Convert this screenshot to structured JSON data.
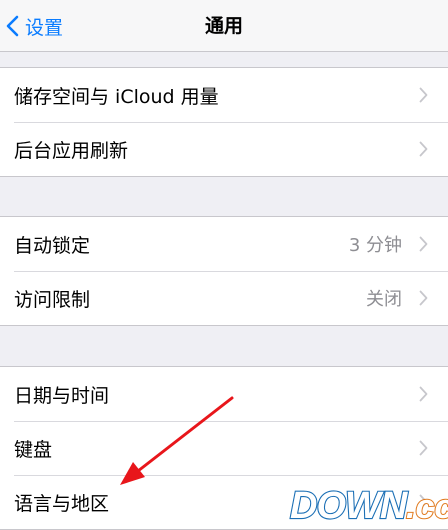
{
  "nav": {
    "back_label": "设置",
    "title": "通用"
  },
  "groups": [
    {
      "rows": [
        {
          "label": "储存空间与 iCloud 用量",
          "value": ""
        },
        {
          "label": "后台应用刷新",
          "value": ""
        }
      ]
    },
    {
      "rows": [
        {
          "label": "自动锁定",
          "value": "3 分钟"
        },
        {
          "label": "访问限制",
          "value": "关闭"
        }
      ]
    },
    {
      "rows": [
        {
          "label": "日期与时间",
          "value": ""
        },
        {
          "label": "键盘",
          "value": ""
        },
        {
          "label": "语言与地区",
          "value": ""
        }
      ]
    }
  ],
  "annotation": {
    "arrow_color": "#e8161b"
  },
  "watermark": {
    "text": "DOWN.cc",
    "color": "#1b6fb5",
    "accent": "#e07a1f"
  },
  "colors": {
    "accent": "#0a7cff",
    "background": "#efeff4",
    "secondary_text": "#8e8e93"
  }
}
